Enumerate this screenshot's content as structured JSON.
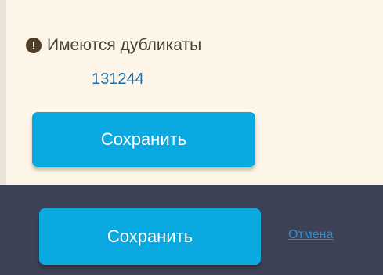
{
  "warning": {
    "icon": "exclamation-circle-icon",
    "message": "Имеются дубликаты",
    "duplicate_id": "131244"
  },
  "buttons": {
    "save_primary": "Сохранить",
    "save_footer": "Сохранить",
    "cancel": "Отмена"
  },
  "colors": {
    "warning_background": "#fdf6e8",
    "footer_background": "#3d4155",
    "button_background": "#0ba9e2",
    "link_color": "#2b8fd1",
    "duplicate_id_color": "#1d6ca8"
  }
}
